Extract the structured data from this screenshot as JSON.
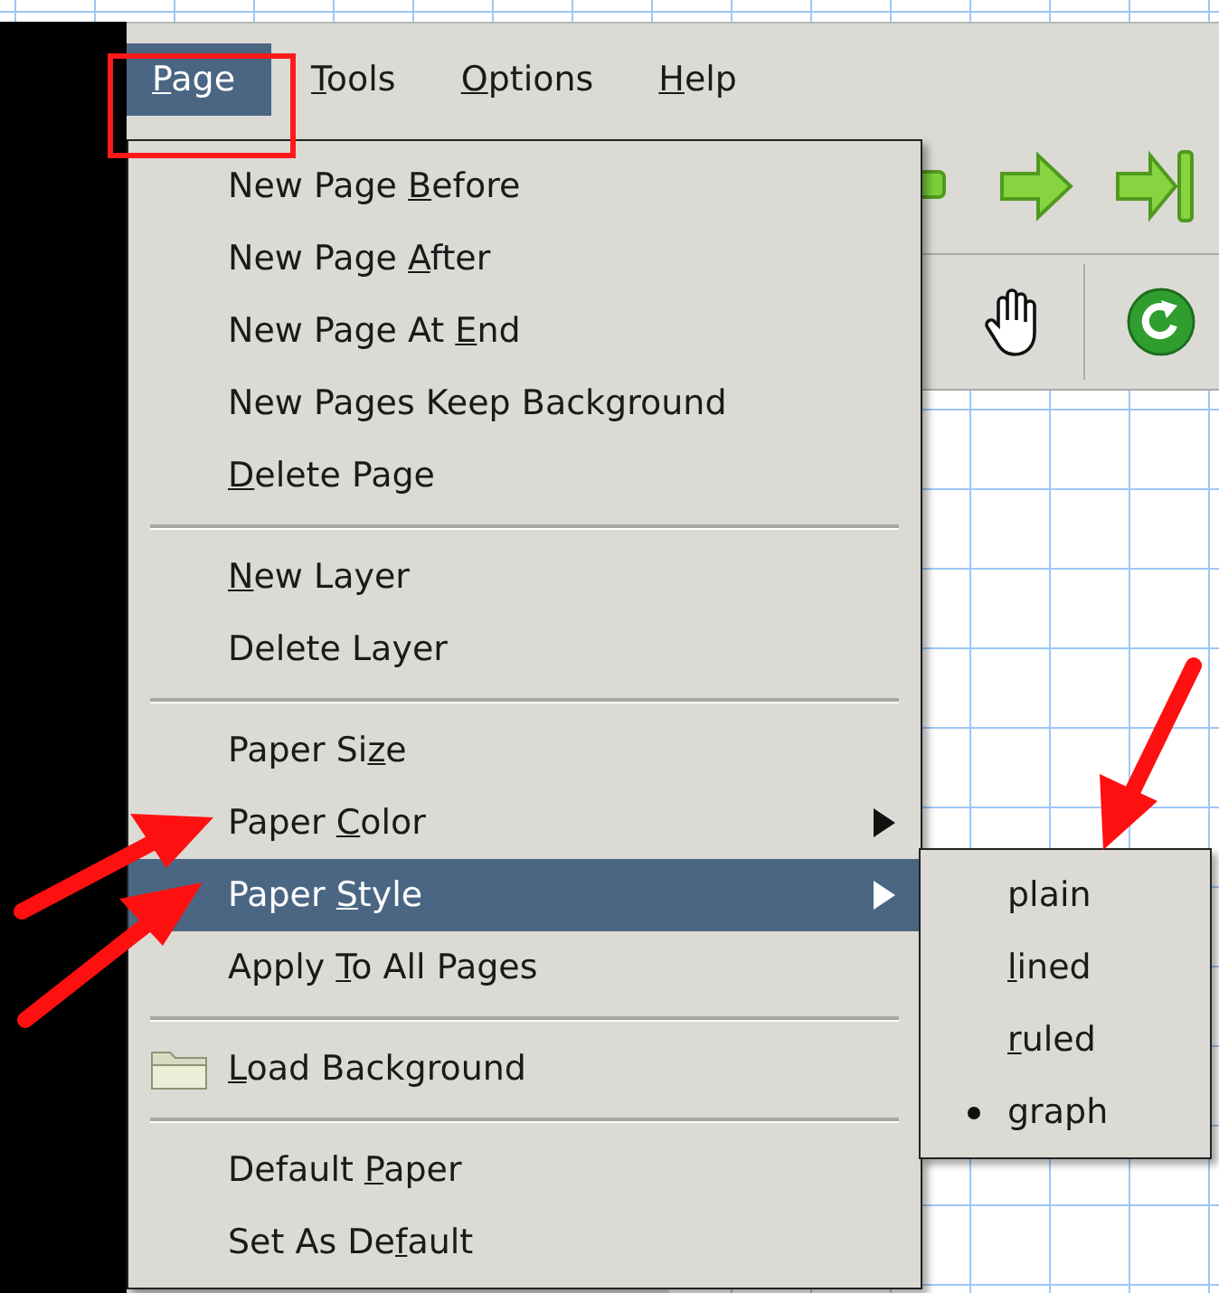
{
  "menubar": [
    {
      "label": [
        {
          "text": "P",
          "underline": true
        },
        {
          "text": "age",
          "underline": false
        }
      ],
      "selected": true
    },
    {
      "label": [
        {
          "text": "T",
          "underline": true
        },
        {
          "text": "ools",
          "underline": false
        }
      ],
      "selected": false
    },
    {
      "label": [
        {
          "text": "O",
          "underline": true
        },
        {
          "text": "ptions",
          "underline": false
        }
      ],
      "selected": false
    },
    {
      "label": [
        {
          "text": "H",
          "underline": true
        },
        {
          "text": "elp",
          "underline": false
        }
      ],
      "selected": false
    }
  ],
  "menu": {
    "items": [
      {
        "kind": "plain",
        "selected": false,
        "label": [
          {
            "text": "New Page ",
            "underline": false
          },
          {
            "text": "B",
            "underline": true
          },
          {
            "text": "efore",
            "underline": false
          }
        ]
      },
      {
        "kind": "plain",
        "selected": false,
        "label": [
          {
            "text": "New Page ",
            "underline": false
          },
          {
            "text": "A",
            "underline": true
          },
          {
            "text": "fter",
            "underline": false
          }
        ]
      },
      {
        "kind": "plain",
        "selected": false,
        "label": [
          {
            "text": "New Page At ",
            "underline": false
          },
          {
            "text": "E",
            "underline": true
          },
          {
            "text": "nd",
            "underline": false
          }
        ]
      },
      {
        "kind": "plain",
        "selected": false,
        "label": [
          {
            "text": "New Pages Keep Background",
            "underline": false
          }
        ]
      },
      {
        "kind": "plain",
        "selected": false,
        "label": [
          {
            "text": "D",
            "underline": true
          },
          {
            "text": "elete Page",
            "underline": false
          }
        ]
      },
      {
        "kind": "separator"
      },
      {
        "kind": "plain",
        "selected": false,
        "label": [
          {
            "text": "N",
            "underline": true
          },
          {
            "text": "ew Layer",
            "underline": false
          }
        ]
      },
      {
        "kind": "plain",
        "selected": false,
        "label": [
          {
            "text": "Delete Layer",
            "underline": false
          }
        ]
      },
      {
        "kind": "separator"
      },
      {
        "kind": "plain",
        "selected": false,
        "label": [
          {
            "text": "Paper Si",
            "underline": false
          },
          {
            "text": "z",
            "underline": true
          },
          {
            "text": "e",
            "underline": false
          }
        ]
      },
      {
        "kind": "submenu",
        "selected": false,
        "label": [
          {
            "text": "Paper ",
            "underline": false
          },
          {
            "text": "C",
            "underline": true
          },
          {
            "text": "olor",
            "underline": false
          }
        ]
      },
      {
        "kind": "submenu",
        "selected": true,
        "label": [
          {
            "text": "Paper ",
            "underline": false
          },
          {
            "text": "S",
            "underline": true
          },
          {
            "text": "tyle",
            "underline": false
          }
        ]
      },
      {
        "kind": "plain",
        "selected": false,
        "label": [
          {
            "text": "Apply ",
            "underline": false
          },
          {
            "text": "T",
            "underline": true
          },
          {
            "text": "o All Pages",
            "underline": false
          }
        ]
      },
      {
        "kind": "separator"
      },
      {
        "kind": "folder",
        "selected": false,
        "label": [
          {
            "text": "L",
            "underline": true
          },
          {
            "text": "oad Background",
            "underline": false
          }
        ]
      },
      {
        "kind": "separator"
      },
      {
        "kind": "plain",
        "selected": false,
        "label": [
          {
            "text": "Default ",
            "underline": false
          },
          {
            "text": "P",
            "underline": true
          },
          {
            "text": "aper",
            "underline": false
          }
        ]
      },
      {
        "kind": "plain",
        "selected": false,
        "label": [
          {
            "text": "Set As De",
            "underline": false
          },
          {
            "text": "f",
            "underline": true
          },
          {
            "text": "ault",
            "underline": false
          }
        ]
      }
    ]
  },
  "submenu": {
    "items": [
      {
        "selected": false,
        "label": [
          {
            "text": "plain",
            "underline": false
          }
        ]
      },
      {
        "selected": false,
        "label": [
          {
            "text": "l",
            "underline": true
          },
          {
            "text": "ined",
            "underline": false
          }
        ]
      },
      {
        "selected": false,
        "label": [
          {
            "text": "r",
            "underline": true
          },
          {
            "text": "uled",
            "underline": false
          }
        ]
      },
      {
        "selected": true,
        "label": [
          {
            "text": "graph",
            "underline": false
          }
        ]
      }
    ]
  }
}
